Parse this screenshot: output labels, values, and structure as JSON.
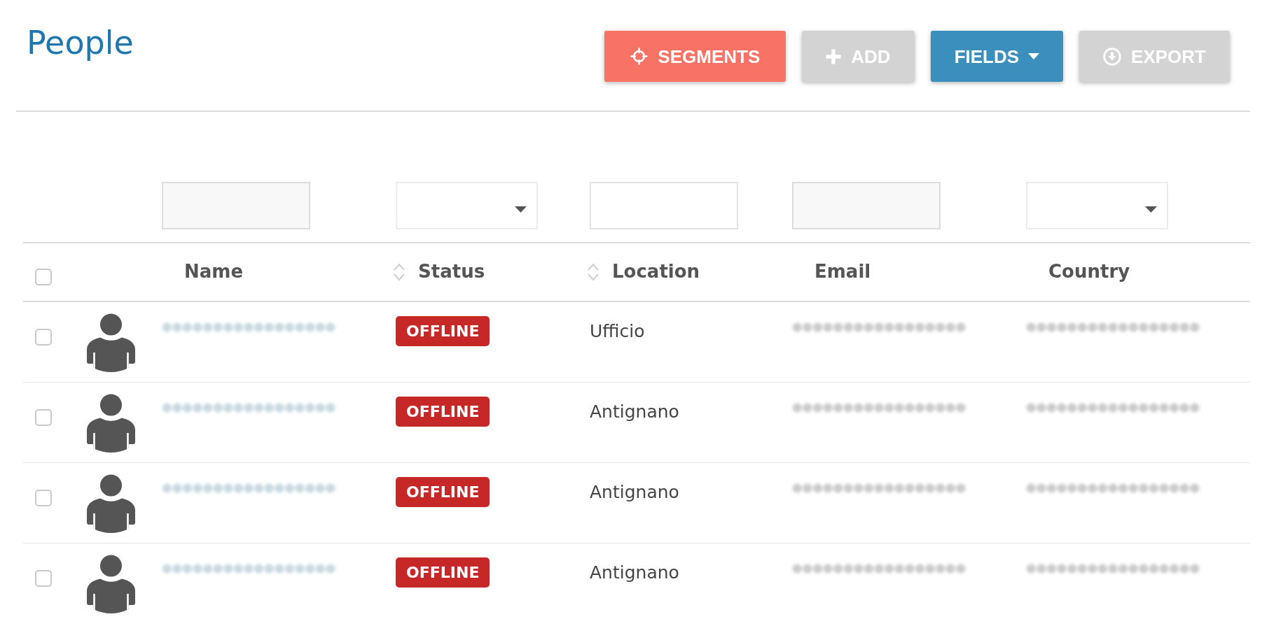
{
  "header": {
    "title": "People",
    "buttons": [
      {
        "label": "SEGMENTS",
        "kind": "action",
        "color": "#f87265"
      },
      {
        "label": "ADD",
        "kind": "action",
        "color": "#d3d3d3"
      },
      {
        "label": "FIELDS",
        "kind": "dropdown",
        "color": "#3b8fbd"
      },
      {
        "label": "EXPORT",
        "kind": "action",
        "color": "#d3d3d3"
      }
    ]
  },
  "table": {
    "filters": [
      {
        "kind": "shaded"
      },
      {
        "kind": "select"
      },
      {
        "kind": "text"
      },
      {
        "kind": "shaded"
      },
      {
        "kind": "select"
      }
    ],
    "select_all": {
      "checked": false
    },
    "columns": [
      {
        "label": "Name",
        "sortable": false
      },
      {
        "label": "Status",
        "sortable": true
      },
      {
        "label": "Location",
        "sortable": true
      },
      {
        "label": "Email",
        "sortable": false
      },
      {
        "label": "Country",
        "sortable": false
      }
    ],
    "rows": [
      {
        "checked": false,
        "status": "OFFLINE",
        "location": "Ufficio"
      },
      {
        "checked": false,
        "status": "OFFLINE",
        "location": "Antignano"
      },
      {
        "checked": false,
        "status": "OFFLINE",
        "location": "Antignano"
      },
      {
        "checked": false,
        "status": "OFFLINE",
        "location": "Antignano"
      }
    ]
  }
}
